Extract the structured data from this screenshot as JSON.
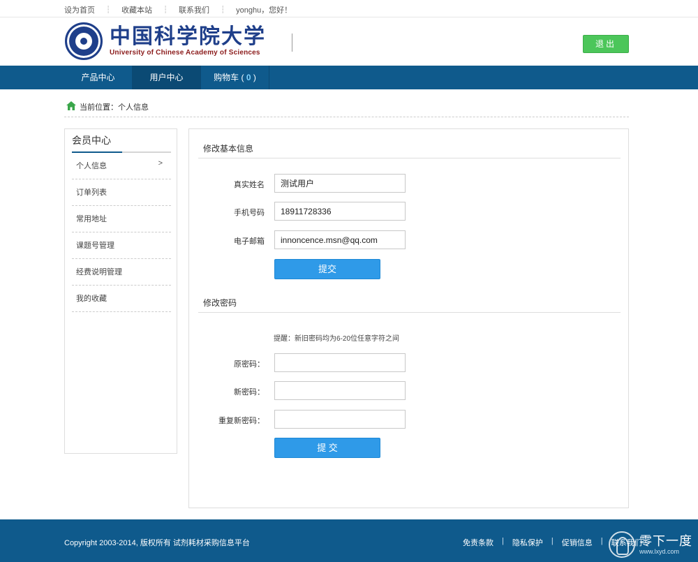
{
  "topbar": {
    "links": [
      "设为首页",
      "收藏本站",
      "联系我们"
    ],
    "greeting": "yonghu，您好！"
  },
  "header": {
    "logo_cn": "中国科学院大学",
    "logo_en": "University of Chinese Academy of Sciences",
    "logout_label": "退出"
  },
  "nav": {
    "items": [
      "产品中心",
      "用户中心",
      "购物车"
    ],
    "cart_count": "0",
    "active": "用户中心"
  },
  "breadcrumb": {
    "label": "当前位置：",
    "current": "个人信息"
  },
  "sidebar": {
    "title": "会员中心",
    "items": [
      "个人信息",
      "订单列表",
      "常用地址",
      "课题号管理",
      "经费说明管理",
      "我的收藏"
    ],
    "active_arrow": ">"
  },
  "basic_info": {
    "title": "修改基本信息",
    "fields": [
      {
        "label": "真实姓名",
        "value": "测试用户"
      },
      {
        "label": "手机号码",
        "value": "18911728336"
      },
      {
        "label": "电子邮箱",
        "value": "innoncence.msn@qq.com"
      }
    ],
    "submit_label": "提交"
  },
  "password": {
    "title": "修改密码",
    "hint": "提醒：新旧密码均为6-20位任意字符之间",
    "fields": [
      {
        "label": "原密码：",
        "value": ""
      },
      {
        "label": "新密码：",
        "value": ""
      },
      {
        "label": "重复新密码：",
        "value": ""
      }
    ],
    "submit_label": "提 交"
  },
  "footer": {
    "copyright": "Copyright 2003-2014, 版权所有 试剂耗材采购信息平台",
    "links": [
      "免责条款",
      "隐私保护",
      "促销信息",
      "联系我们"
    ]
  },
  "watermark": {
    "cn": "零下一度",
    "en": "www.lxyd.com"
  },
  "colors": {
    "nav_bg": "#0f5a8c",
    "nav_active": "#0b4a74",
    "logout_green": "#4cc65a",
    "submit_blue": "#2f9ae8"
  }
}
